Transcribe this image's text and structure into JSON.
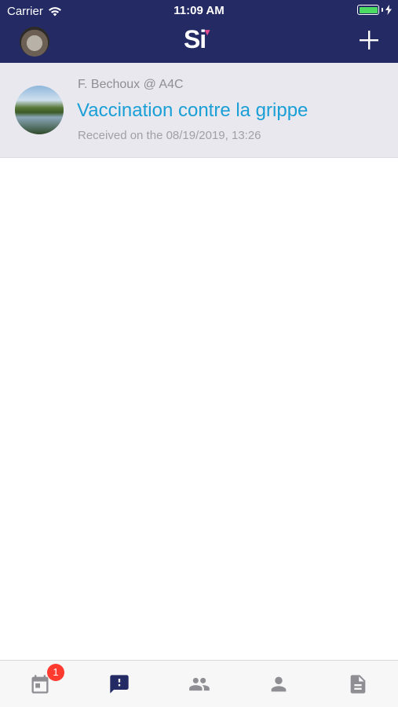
{
  "status_bar": {
    "carrier": "Carrier",
    "time": "11:09 AM"
  },
  "nav": {
    "logo": "Si",
    "avatar_icon": "user-avatar-photo",
    "add_icon": "plus-icon",
    "colors": {
      "background": "#242a63",
      "logo_accent": "#e14b8f"
    }
  },
  "messages": [
    {
      "sender": "F. Bechoux @ A4C",
      "subject": "Vaccination contre la grippe",
      "received": "Received on the 08/19/2019, 13:26",
      "subject_color": "#1a9fd6"
    }
  ],
  "tabbar": {
    "tabs": [
      {
        "name": "calendar",
        "icon": "calendar-icon",
        "badge": "1",
        "active": false
      },
      {
        "name": "alerts",
        "icon": "message-alert-icon",
        "active": true
      },
      {
        "name": "groups",
        "icon": "people-icon",
        "active": false
      },
      {
        "name": "profile",
        "icon": "person-icon",
        "active": false
      },
      {
        "name": "documents",
        "icon": "document-icon",
        "active": false
      }
    ],
    "colors": {
      "active": "#242a63",
      "inactive": "#8e8e93",
      "badge": "#ff3b30"
    }
  }
}
